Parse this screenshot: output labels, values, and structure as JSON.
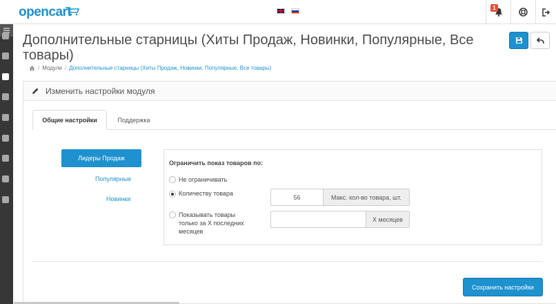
{
  "header": {
    "logo_text": "opencart",
    "notification_count": "1"
  },
  "page": {
    "title": "Дополнительные старницы (Хиты Продаж, Новинки, Популярные, Все товары)"
  },
  "breadcrumb": {
    "modules": "Модули",
    "current": "Дополнительные старницы (Хиты Продаж, Новинки, Популярные, Все товары)"
  },
  "panel": {
    "title": "Изменить настройки модуля"
  },
  "tabs": [
    {
      "label": "Общие настройки",
      "active": true
    },
    {
      "label": "Поддержка",
      "active": false
    }
  ],
  "pills": [
    {
      "label": "Лидеры Продаж",
      "active": true
    },
    {
      "label": "Популярные",
      "active": false
    },
    {
      "label": "Новинки",
      "active": false
    }
  ],
  "settings": {
    "heading": "Ограничить показ товаров по:",
    "options": [
      {
        "label": "Не ограничивать",
        "checked": false
      },
      {
        "label": "Количеству товара",
        "checked": true
      },
      {
        "label": "Показывать товары только за X последних месяцев",
        "checked": false
      }
    ],
    "qty_value": "56",
    "qty_addon": "Макс. кол-во товара, шт.",
    "months_value": "",
    "months_addon": "X месяцев"
  },
  "actions": {
    "save_settings": "Сохранить настройки"
  },
  "colors": {
    "accent": "#1e91cf",
    "sidebar": "#373737",
    "badge": "#e3503e"
  },
  "icons": {
    "cart": "cart-icon",
    "bell": "bell-icon",
    "help": "lifebuoy-icon",
    "logout": "logout-icon",
    "save": "floppy-icon",
    "back": "reply-icon",
    "home": "home-icon",
    "pencil": "pencil-icon"
  }
}
